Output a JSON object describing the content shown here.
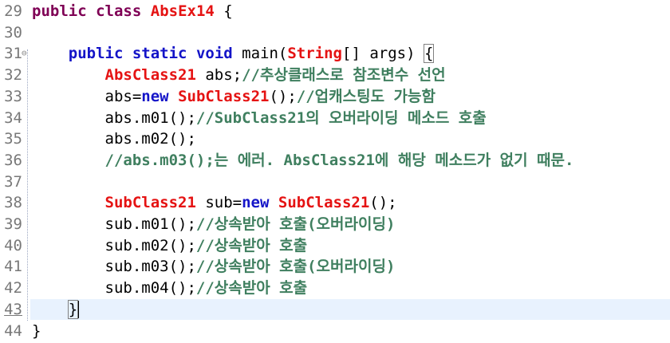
{
  "editor": {
    "lines": [
      {
        "num": "29",
        "tokens": [
          [
            "kw",
            "public"
          ],
          [
            "plain",
            " "
          ],
          [
            "kw",
            "class"
          ],
          [
            "plain",
            " "
          ],
          [
            "type",
            "AbsEx14"
          ],
          [
            "plain",
            " {"
          ]
        ]
      },
      {
        "num": "30",
        "tokens": []
      },
      {
        "num": "31",
        "fold": "⊖",
        "tokens": [
          [
            "plain",
            "    "
          ],
          [
            "kw2",
            "public"
          ],
          [
            "plain",
            " "
          ],
          [
            "kw2",
            "static"
          ],
          [
            "plain",
            " "
          ],
          [
            "kw2",
            "void"
          ],
          [
            "plain",
            " main("
          ],
          [
            "type",
            "String"
          ],
          [
            "plain",
            "[] args) "
          ],
          [
            "bracket",
            "{"
          ]
        ]
      },
      {
        "num": "32",
        "tokens": [
          [
            "plain",
            "        "
          ],
          [
            "type",
            "AbsClass21"
          ],
          [
            "plain",
            " abs;"
          ],
          [
            "cm",
            "//추상클래스로 참조변수 선언"
          ]
        ]
      },
      {
        "num": "33",
        "tokens": [
          [
            "plain",
            "        abs="
          ],
          [
            "kw2",
            "new"
          ],
          [
            "plain",
            " "
          ],
          [
            "type",
            "SubClass21"
          ],
          [
            "plain",
            "();"
          ],
          [
            "cm",
            "//업캐스팅도 가능함"
          ]
        ]
      },
      {
        "num": "34",
        "tokens": [
          [
            "plain",
            "        abs.m01();"
          ],
          [
            "cm",
            "//SubClass21의 오버라이딩 메소드 호출"
          ]
        ]
      },
      {
        "num": "35",
        "tokens": [
          [
            "plain",
            "        abs.m02();"
          ]
        ]
      },
      {
        "num": "36",
        "tokens": [
          [
            "plain",
            "        "
          ],
          [
            "cm",
            "//abs.m03();는 에러. AbsClass21에 해당 메소드가 없기 때문."
          ]
        ]
      },
      {
        "num": "37",
        "tokens": []
      },
      {
        "num": "38",
        "tokens": [
          [
            "plain",
            "        "
          ],
          [
            "type",
            "SubClass21"
          ],
          [
            "plain",
            " sub="
          ],
          [
            "kw2",
            "new"
          ],
          [
            "plain",
            " "
          ],
          [
            "type",
            "SubClass21"
          ],
          [
            "plain",
            "();"
          ]
        ]
      },
      {
        "num": "39",
        "tokens": [
          [
            "plain",
            "        sub.m01();"
          ],
          [
            "cm",
            "//상속받아 호출(오버라이딩)"
          ]
        ]
      },
      {
        "num": "40",
        "tokens": [
          [
            "plain",
            "        sub.m02();"
          ],
          [
            "cm",
            "//상속받아 호출"
          ]
        ]
      },
      {
        "num": "41",
        "tokens": [
          [
            "plain",
            "        sub.m03();"
          ],
          [
            "cm",
            "//상속받아 호출(오버라이딩)"
          ]
        ]
      },
      {
        "num": "42",
        "tokens": [
          [
            "plain",
            "        sub.m04();"
          ],
          [
            "cm",
            "//상속받아 호출"
          ]
        ]
      },
      {
        "num": "43",
        "current": true,
        "tokens": [
          [
            "plain",
            "    "
          ],
          [
            "bracket",
            "}"
          ],
          [
            "caret",
            ""
          ]
        ]
      },
      {
        "num": "44",
        "tokens": [
          [
            "plain",
            "}"
          ]
        ]
      }
    ]
  }
}
